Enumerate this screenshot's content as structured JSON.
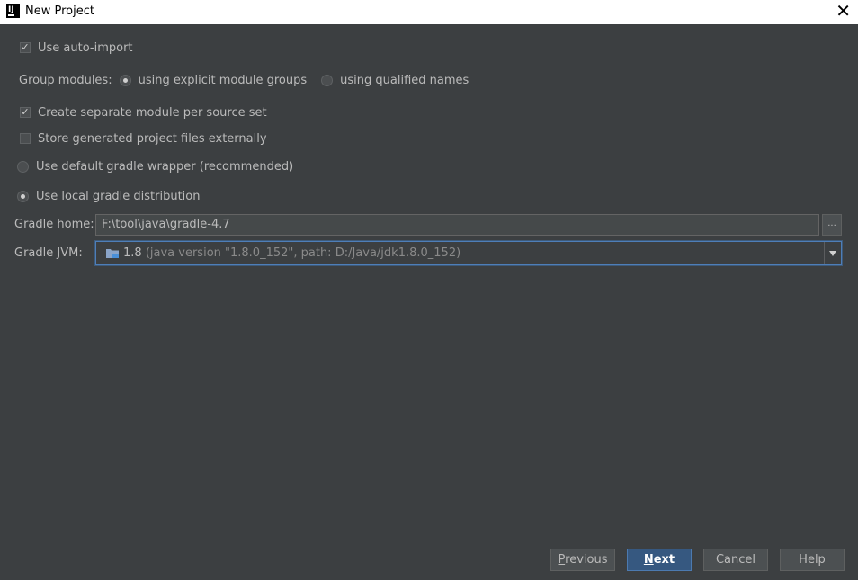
{
  "window": {
    "title": "New Project",
    "app_icon_text": "IJ",
    "close_glyph": "✕"
  },
  "options": {
    "use_auto_import": {
      "label": "Use auto-import",
      "checked": true
    },
    "group_modules": {
      "label": "Group modules:",
      "options": [
        {
          "label": "using explicit module groups",
          "selected": true
        },
        {
          "label": "using qualified names",
          "selected": false
        }
      ]
    },
    "create_separate_module": {
      "label": "Create separate module per source set",
      "checked": true
    },
    "store_generated_externally": {
      "label": "Store generated project files externally",
      "checked": false
    },
    "gradle_distribution": {
      "options": [
        {
          "label": "Use default gradle wrapper (recommended)",
          "selected": false
        },
        {
          "label": "Use local gradle distribution",
          "selected": true
        }
      ]
    }
  },
  "gradle_home": {
    "label": "Gradle home:",
    "value": "F:\\tool\\java\\gradle-4.7",
    "browse_label": "..."
  },
  "gradle_jvm": {
    "label": "Gradle JVM:",
    "selected_value": "1.8",
    "selected_detail": "(java version \"1.8.0_152\", path: D:/Java/jdk1.8.0_152)"
  },
  "buttons": {
    "previous": {
      "mnemonic": "P",
      "rest": "revious"
    },
    "next": {
      "mnemonic": "N",
      "rest": "ext"
    },
    "cancel": "Cancel",
    "help": "Help"
  },
  "icons": {
    "app": "intellij-icon",
    "close": "close-icon",
    "jdk": "jdk-folder-icon",
    "dropdown": "chevron-down-icon"
  },
  "colors": {
    "background": "#3c3f41",
    "focus_border": "#4e7eb8",
    "default_button": "#365880"
  }
}
